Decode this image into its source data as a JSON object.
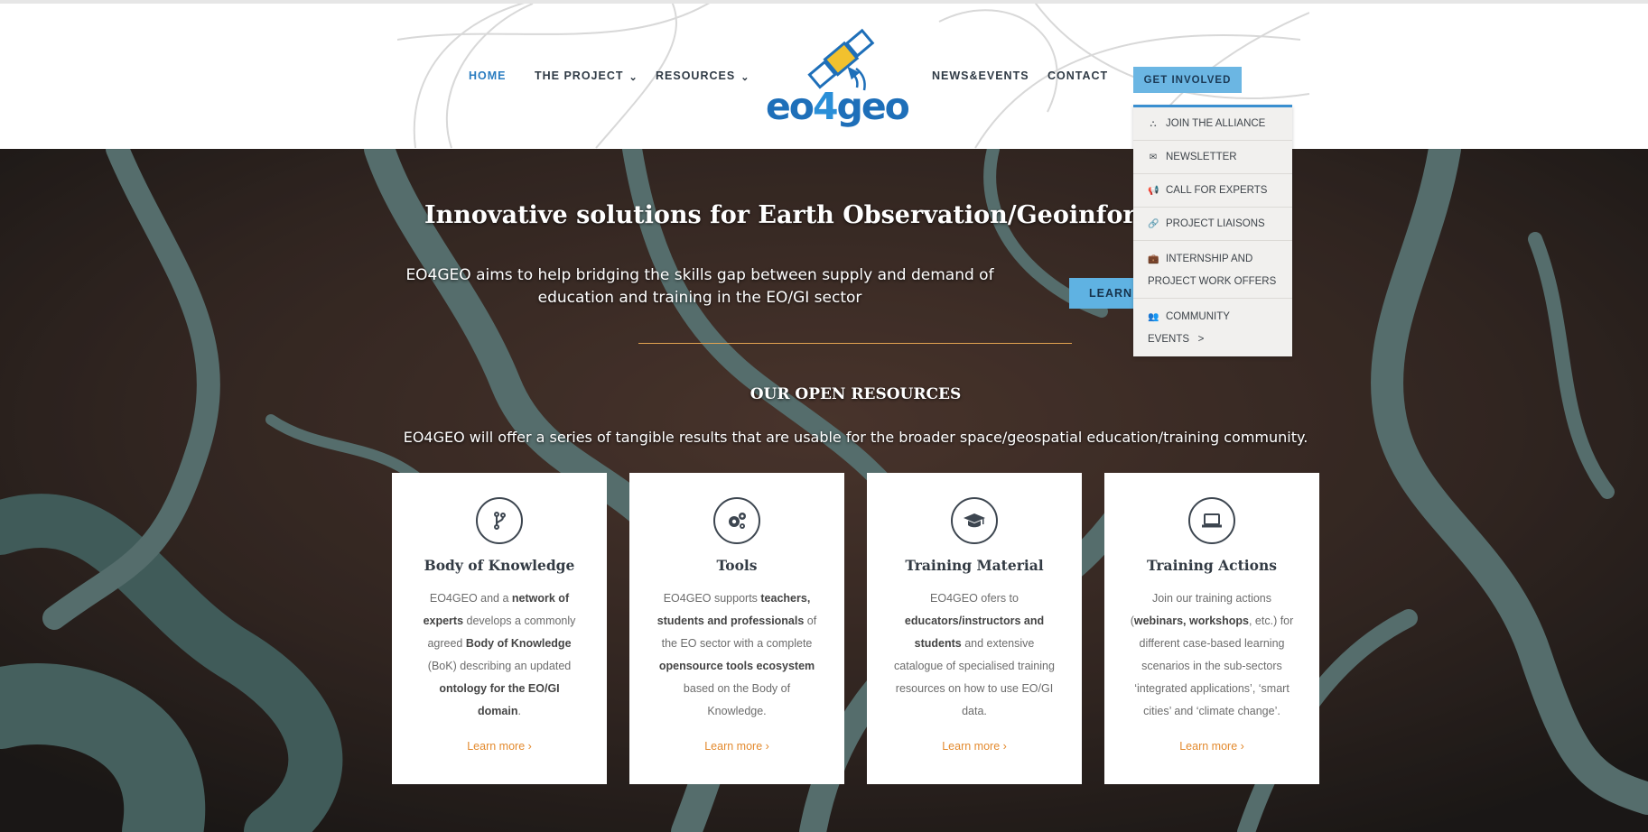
{
  "nav": {
    "home": "HOME",
    "project": "THE PROJECT",
    "resources": "RESOURCES",
    "news": "NEWS&EVENTS",
    "contact": "CONTACT",
    "get_involved": "GET INVOLVED",
    "chevron": "⌄"
  },
  "logo": {
    "pre": "eo",
    "four": "4",
    "post": "geo"
  },
  "dropdown": {
    "items": [
      {
        "icon": "sitemap-icon",
        "label": "JOIN THE ALLIANCE"
      },
      {
        "icon": "envelope-icon",
        "label": "NEWSLETTER"
      },
      {
        "icon": "bullhorn-icon",
        "label": "CALL FOR EXPERTS"
      },
      {
        "icon": "link-icon",
        "label": "PROJECT LIAISONS"
      },
      {
        "icon": "briefcase-icon",
        "label": "INTERNSHIP AND",
        "label2": "PROJECT WORK OFFERS"
      },
      {
        "icon": "users-icon",
        "label": "COMMUNITY",
        "label2": "EVENTS   >"
      }
    ]
  },
  "hero": {
    "title": "Innovative solutions for Earth Observation/Geoinformation",
    "subtitle": "EO4GEO aims to help bridging the skills gap between supply and demand of education and training in the EO/GI sector",
    "learn_more": "LEARN MORE",
    "resources_title": "OUR OPEN RESOURCES",
    "resources_sub": "EO4GEO will offer a series of tangible results that are usable for the broader space/geospatial education/training community."
  },
  "cards": [
    {
      "icon": "branch-icon",
      "title": "Body of Knowledge",
      "body_html": "EO4GEO and a <b>network of experts</b> develops a commonly agreed <b>Body of Knowledge</b> (BoK) describing an updated <b>ontology for the EO/GI domain</b>.",
      "link": "Learn more ›"
    },
    {
      "icon": "cogs-icon",
      "title": "Tools",
      "body_html": "EO4GEO supports <b>teachers, students and professionals</b> of the EO sector with a complete <b>opensource tools ecosystem</b> based on the Body of Knowledge.",
      "link": "Learn more ›"
    },
    {
      "icon": "graduation-cap-icon",
      "title": "Training Material",
      "body_html": "EO4GEO ofers to <b>educators/instructors and students</b> and extensive catalogue of specialised training resources on how to use EO/GI data.",
      "link": "Learn more ›"
    },
    {
      "icon": "laptop-icon",
      "title": "Training Actions",
      "body_html": "Join our training actions (<b>webinars, workshops</b>, etc.) for different case-based learning scenarios in the sub-sectors ‘integrated applications’, ‘smart cities’ and ‘climate change’.",
      "link": "Learn more ›"
    }
  ],
  "colors": {
    "accent_blue": "#2a7cc0",
    "button_blue": "#6bb6e3",
    "link_orange": "#e38a2e",
    "divider_orange": "#e2a250"
  }
}
